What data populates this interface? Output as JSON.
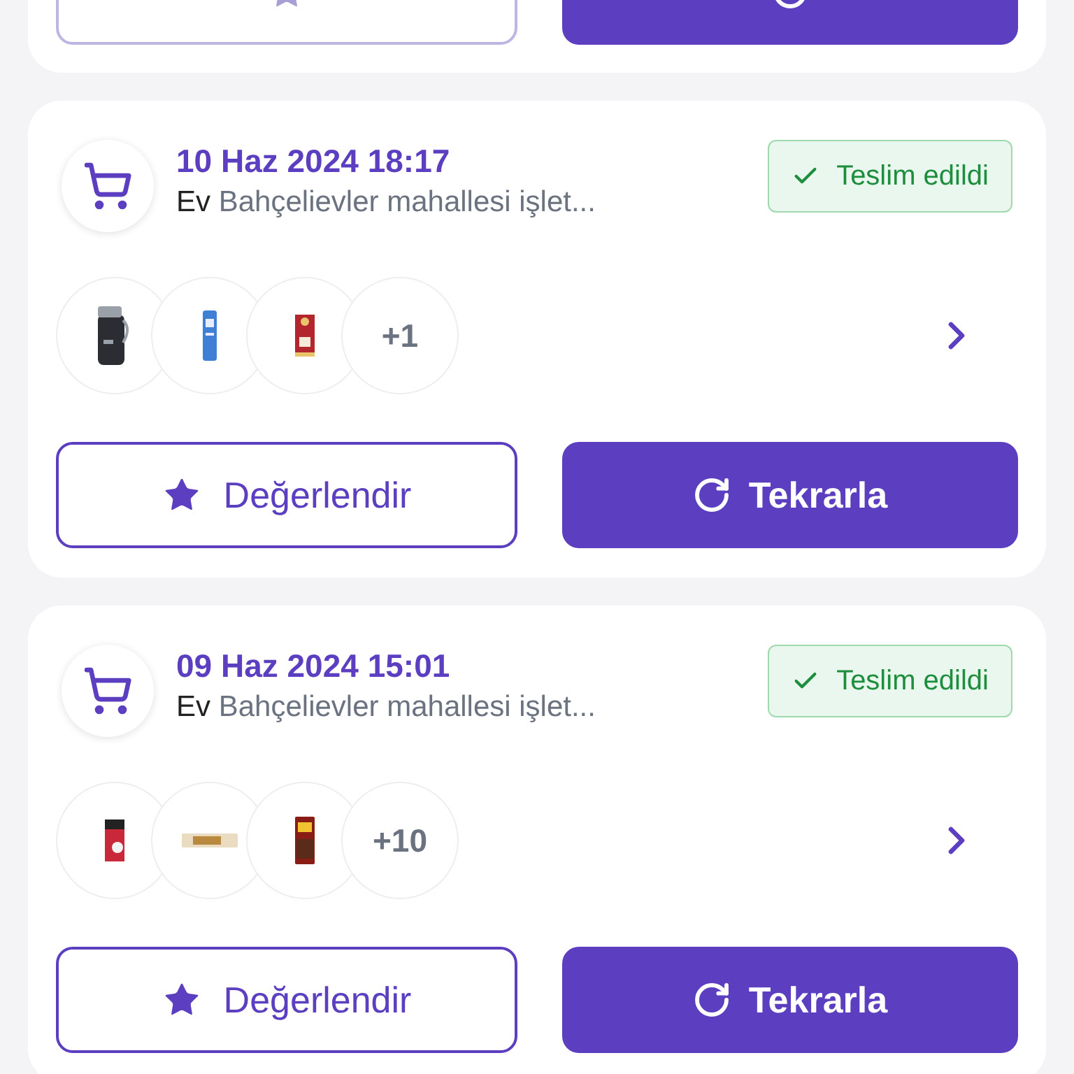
{
  "orders": [
    {
      "review_button": {
        "disabled": true
      }
    },
    {
      "date": "10 Haz 2024 18:17",
      "address_label": "Ev",
      "address": "Bahçelievler mahallesi işlet...",
      "status": "Teslim edildi",
      "more": "+1",
      "review_button": {
        "label": "Değerlendir",
        "disabled": false
      },
      "repeat_button": {
        "label": "Tekrarla"
      }
    },
    {
      "date": "09 Haz 2024 15:01",
      "address_label": "Ev",
      "address": "Bahçelievler mahallesi işlet...",
      "status": "Teslim edildi",
      "more": "+10",
      "review_button": {
        "label": "Değerlendir",
        "disabled": false
      },
      "repeat_button": {
        "label": "Tekrarla"
      }
    }
  ]
}
